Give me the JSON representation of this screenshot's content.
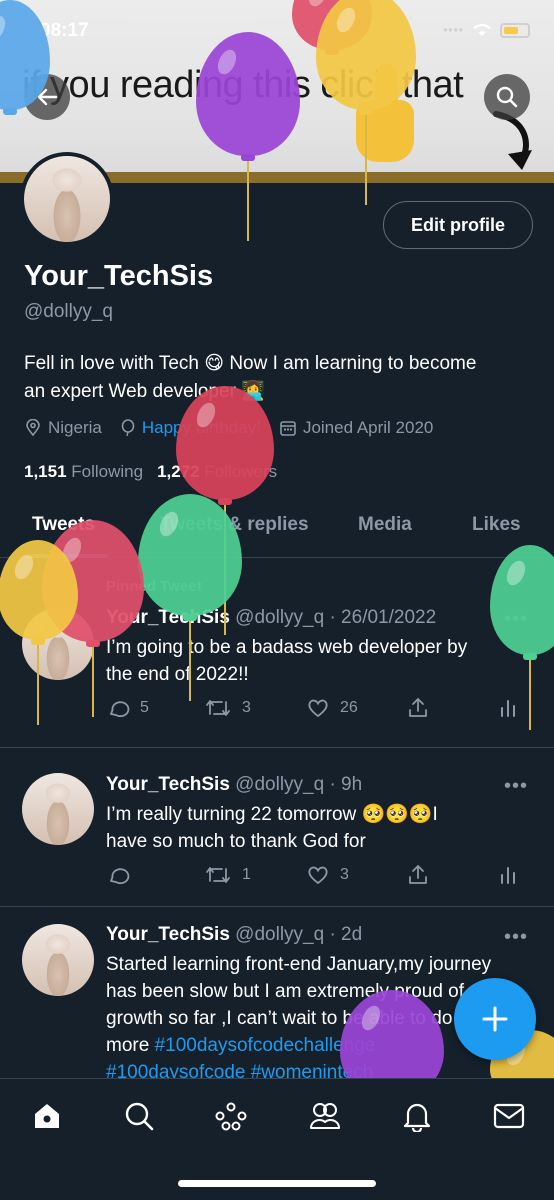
{
  "status_bar": {
    "time": "08:17"
  },
  "banner": {
    "text": "if you reading this click that"
  },
  "profile": {
    "edit_button": "Edit profile",
    "display_name": "Your_TechSis",
    "handle": "@dollyy_q",
    "bio_line1": "Fell in love with Tech 😋 Now I am learning to become",
    "bio_line2": "an expert Web developer 👩‍💻",
    "location": "Nigeria",
    "birthday": "Happy birthday!",
    "joined": "Joined April 2020",
    "following_count": "1,151",
    "following_label": "Following",
    "followers_count": "1,272",
    "followers_label": "Followers"
  },
  "tabs": [
    "Tweets",
    "Tweets & replies",
    "Media",
    "Likes"
  ],
  "tweets": [
    {
      "pinned_label": "Pinned Tweet",
      "name": "Your_TechSis",
      "meta": "@dollyy_q · 26/01/2022",
      "line1": "I’m going to be a badass web developer by",
      "line2": "the end of 2022!!",
      "replies": "5",
      "retweets": "3",
      "likes": "26"
    },
    {
      "name": "Your_TechSis",
      "meta": "@dollyy_q · 9h",
      "line1": "I’m really turning 22 tomorrow 🥺🥺🥺I",
      "line2": "have so much to thank God for",
      "replies": "",
      "retweets": "1",
      "likes": "3"
    },
    {
      "name": "Your_TechSis",
      "meta": "@dollyy_q · 2d",
      "line1": "Started learning front-end January,my journey",
      "line2": "has been slow but I am extremely proud of my",
      "line3": "growth so far ,I can’t wait to be able to do",
      "line4_text": "more ",
      "line4_tag": "#100daysofcodechallenge",
      "line5_tag1": "#100daysofcode",
      "line5_tag2": "#womenintech"
    }
  ],
  "icons": {
    "back": "arrow-left-icon",
    "search": "search-icon",
    "compose": "plus-icon",
    "nav": [
      "home-icon",
      "search-icon",
      "spaces-icon",
      "communities-icon",
      "notifications-icon",
      "messages-icon"
    ]
  },
  "colors": {
    "background": "#15202b",
    "accent": "#1d9bf0",
    "muted": "#8b98a5",
    "divider": "#38444d"
  }
}
